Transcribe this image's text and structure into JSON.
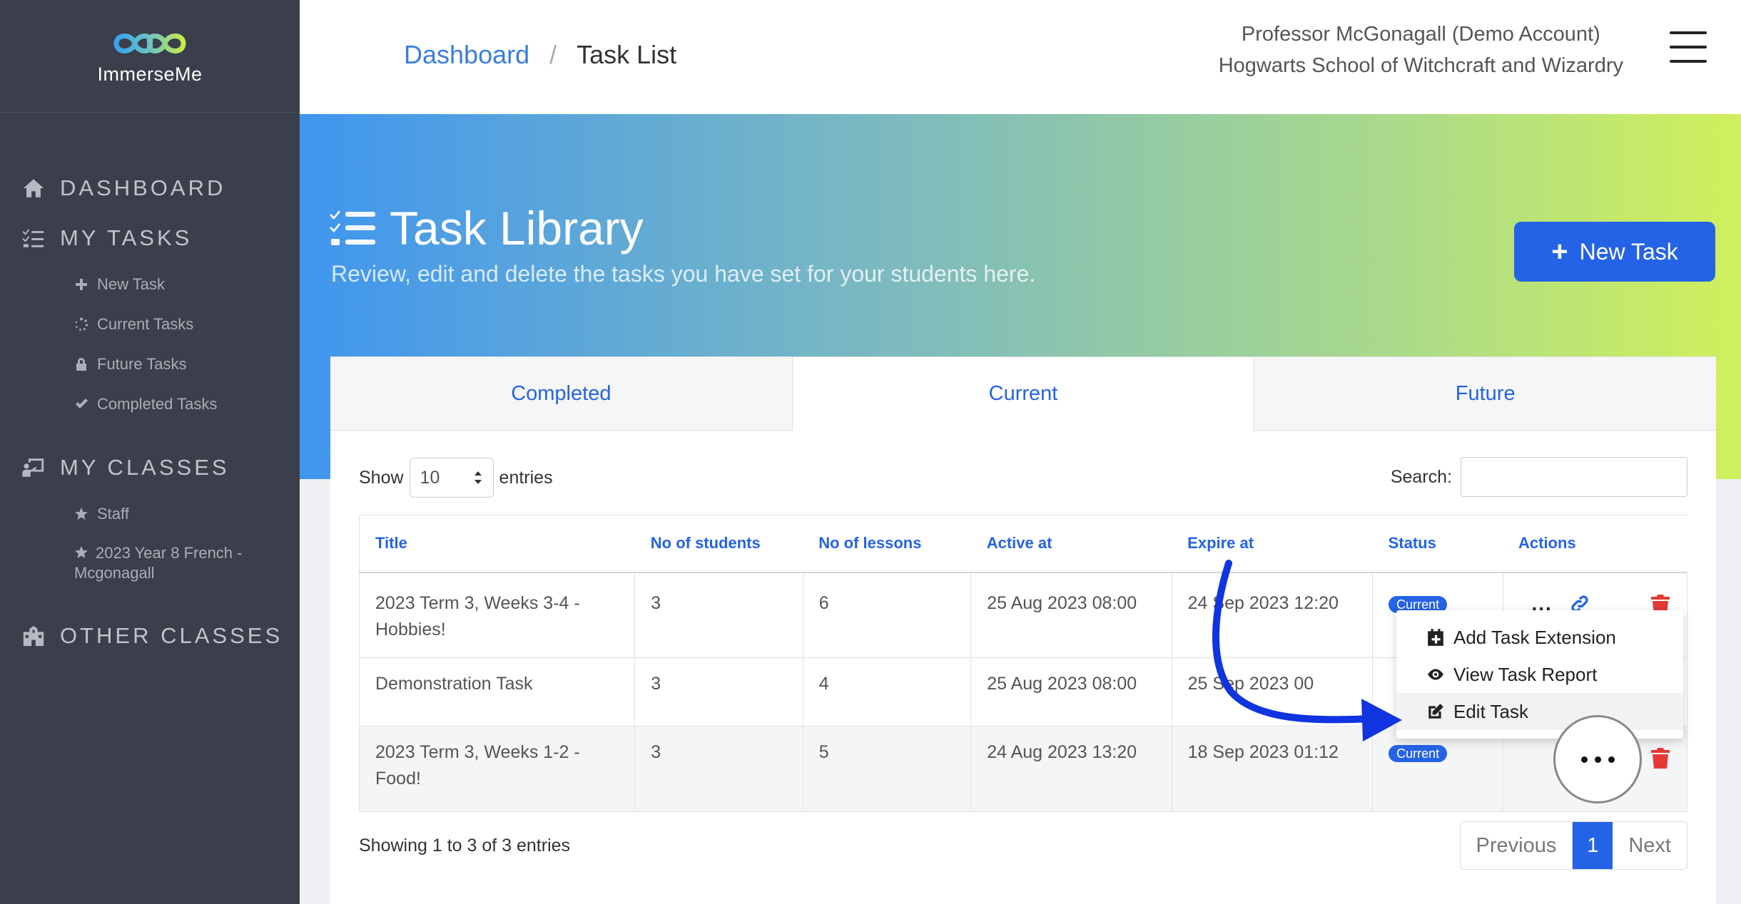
{
  "brand": {
    "name": "ImmerseMe"
  },
  "sidebar": {
    "dashboard": "DASHBOARD",
    "my_tasks": "MY TASKS",
    "task_items": [
      "New Task",
      "Current Tasks",
      "Future Tasks",
      "Completed Tasks"
    ],
    "my_classes": "MY CLASSES",
    "class_items": [
      "Staff",
      "2023 Year 8 French - Mcgonagall"
    ],
    "other_classes": "OTHER CLASSES"
  },
  "header": {
    "breadcrumb_root": "Dashboard",
    "breadcrumb_sep": "/",
    "breadcrumb_current": "Task List",
    "user_name": "Professor McGonagall (Demo Account)",
    "school": "Hogwarts School of Witchcraft and Wizardry"
  },
  "hero": {
    "title": "Task Library",
    "subtitle": "Review, edit and delete the tasks you have set for your students here.",
    "new_task": "New Task"
  },
  "tabs": [
    "Completed",
    "Current",
    "Future"
  ],
  "controls": {
    "show": "Show",
    "entries_value": "10",
    "entries": "entries",
    "search": "Search:",
    "search_value": ""
  },
  "table": {
    "headers": [
      "Title",
      "No of students",
      "No of lessons",
      "Active at",
      "Expire at",
      "Status",
      "Actions"
    ],
    "rows": [
      {
        "title": "2023 Term 3, Weeks 3-4 - Hobbies!",
        "students": "3",
        "lessons": "6",
        "active": "25 Aug 2023 08:00",
        "expire": "24 Sep 2023 12:20",
        "status": "Current"
      },
      {
        "title": "Demonstration Task",
        "students": "3",
        "lessons": "4",
        "active": "25 Aug 2023 08:00",
        "expire": "25 Sep 2023 00",
        "status": ""
      },
      {
        "title": "2023 Term 3, Weeks 1-2 - Food!",
        "students": "3",
        "lessons": "5",
        "active": "24 Aug 2023 13:20",
        "expire": "18 Sep 2023 01:12",
        "status": "Current"
      }
    ],
    "dots": "..."
  },
  "dropdown": {
    "items": [
      "Add Task Extension",
      "View Task Report",
      "Edit Task"
    ]
  },
  "footer": {
    "showing": "Showing 1 to 3 of 3 entries",
    "previous": "Previous",
    "page": "1",
    "next": "Next"
  },
  "colors": {
    "accent": "#2563e6",
    "sidebar": "#3a3f4b",
    "danger": "#e53935",
    "annotation": "#1034e0"
  }
}
